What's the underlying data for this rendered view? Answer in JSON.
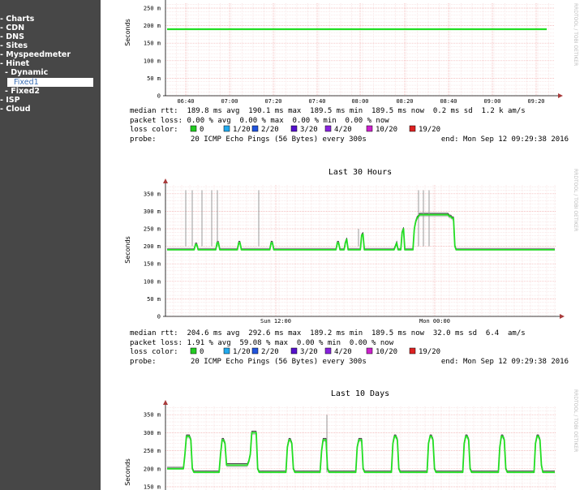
{
  "sidebar": {
    "items": [
      {
        "label": "- Charts"
      },
      {
        "label": "- CDN"
      },
      {
        "label": "- DNS"
      },
      {
        "label": "- Sites"
      },
      {
        "label": "- Myspeedmeter"
      },
      {
        "label": "- Hinet"
      },
      {
        "label": "- Dynamic"
      },
      {
        "label": "Fixed1",
        "selected": true
      },
      {
        "label": "- Fixed2"
      },
      {
        "label": "- ISP"
      },
      {
        "label": "- Cloud"
      }
    ]
  },
  "watermark": "RRDTOOL / TOBI OETIKER",
  "colors": {
    "sidebar_bg": "#474747",
    "selected_text": "#3b6fb5",
    "median_line": "#22dd22",
    "grid_major": "#f2a8a8",
    "grid_minor": "#f6dada",
    "axis_arrow": "#a83b3b"
  },
  "legend_colors": [
    {
      "label": "0",
      "color": "#22cc22"
    },
    {
      "label": "1/20",
      "color": "#22aaee"
    },
    {
      "label": "2/20",
      "color": "#2255dd"
    },
    {
      "label": "3/20",
      "color": "#5511cc"
    },
    {
      "label": "4/20",
      "color": "#8822dd"
    },
    {
      "label": "10/20",
      "color": "#cc22cc"
    },
    {
      "label": "19/20",
      "color": "#dd2222"
    }
  ],
  "chart_data": [
    {
      "type": "line",
      "title": "",
      "ylabel": "Seconds",
      "y_ticks": [
        "0",
        "50 m",
        "100 m",
        "150 m",
        "200 m",
        "250 m"
      ],
      "ylim": [
        0,
        0.25
      ],
      "x_ticks": [
        "06:40",
        "07:00",
        "07:20",
        "07:40",
        "08:00",
        "08:20",
        "08:40",
        "09:00",
        "09:20"
      ],
      "series": [
        {
          "values": [
            0.1898,
            0.1898
          ]
        }
      ],
      "stats": {
        "median_rtt": "median rtt:  189.8 ms avg  190.1 ms max  189.5 ms min  189.5 ms now  0.2 ms sd  1.2 k am/s",
        "packet_loss": "packet loss: 0.00 % avg  0.00 % max  0.00 % min  0.00 % now",
        "loss_color_label": "loss color:",
        "probe_label": "probe:",
        "probe": "20 ICMP Echo Pings (56 Bytes) every 300s",
        "end": "end: Mon Sep 12 09:29:38 2016"
      }
    },
    {
      "type": "line",
      "title": "Last 30 Hours",
      "ylabel": "Seconds",
      "y_ticks": [
        "0",
        "50 m",
        "100 m",
        "150 m",
        "200 m",
        "250 m",
        "300 m",
        "350 m"
      ],
      "ylim": [
        0,
        0.375
      ],
      "x_ticks": [
        "Sun 12:00",
        "Mon 00:00"
      ],
      "series": [
        {
          "values": [
            0.19,
            0.19,
            0.19,
            0.19,
            0.19,
            0.19,
            0.19,
            0.19,
            0.19,
            0.19,
            0.19,
            0.19,
            0.19,
            0.19,
            0.19,
            0.19,
            0.19,
            0.19,
            0.19,
            0.19,
            0.19,
            0.205,
            0.205,
            0.19,
            0.19,
            0.19,
            0.19,
            0.19,
            0.19,
            0.19,
            0.19,
            0.19,
            0.19,
            0.19,
            0.19,
            0.19,
            0.19,
            0.21,
            0.21,
            0.19,
            0.19,
            0.19,
            0.19,
            0.19,
            0.19,
            0.19,
            0.19,
            0.19,
            0.19,
            0.19,
            0.19,
            0.19,
            0.19,
            0.21,
            0.21,
            0.19,
            0.19,
            0.19,
            0.19,
            0.19,
            0.19,
            0.19,
            0.19,
            0.19,
            0.19,
            0.19,
            0.19,
            0.19,
            0.19,
            0.19,
            0.19,
            0.19,
            0.19,
            0.19,
            0.19,
            0.19,
            0.19,
            0.21,
            0.21,
            0.19,
            0.19,
            0.19,
            0.19,
            0.19,
            0.19,
            0.19,
            0.19,
            0.19,
            0.19,
            0.19,
            0.19,
            0.19,
            0.19,
            0.19,
            0.19,
            0.19,
            0.19,
            0.19,
            0.19,
            0.19,
            0.19,
            0.19,
            0.19,
            0.19,
            0.19,
            0.19,
            0.19,
            0.19,
            0.19,
            0.19,
            0.19,
            0.19,
            0.19,
            0.19,
            0.19,
            0.19,
            0.19,
            0.19,
            0.19,
            0.19,
            0.19,
            0.19,
            0.19,
            0.19,
            0.19,
            0.19,
            0.21,
            0.21,
            0.19,
            0.19,
            0.19,
            0.19,
            0.21,
            0.22,
            0.19,
            0.19,
            0.19,
            0.19,
            0.19,
            0.19,
            0.19,
            0.19,
            0.19,
            0.19,
            0.23,
            0.235,
            0.19,
            0.19,
            0.19,
            0.19,
            0.19,
            0.19,
            0.19,
            0.19,
            0.19,
            0.19,
            0.19,
            0.19,
            0.19,
            0.19,
            0.19,
            0.19,
            0.19,
            0.19,
            0.19,
            0.19,
            0.19,
            0.19,
            0.19,
            0.2,
            0.21,
            0.19,
            0.19,
            0.19,
            0.24,
            0.25,
            0.19,
            0.19,
            0.19,
            0.19,
            0.19,
            0.19,
            0.19,
            0.25,
            0.27,
            0.28,
            0.285,
            0.29,
            0.29,
            0.29,
            0.29,
            0.29,
            0.29,
            0.29,
            0.29,
            0.29,
            0.29,
            0.29,
            0.29,
            0.29,
            0.29,
            0.29,
            0.29,
            0.29,
            0.29,
            0.29,
            0.29,
            0.29,
            0.29,
            0.285,
            0.285,
            0.28,
            0.28,
            0.2,
            0.19,
            0.19,
            0.19,
            0.19,
            0.19,
            0.19,
            0.19,
            0.19,
            0.19,
            0.19,
            0.19,
            0.19,
            0.19,
            0.19,
            0.19,
            0.19,
            0.19,
            0.19,
            0.19,
            0.19,
            0.19,
            0.19,
            0.19,
            0.19,
            0.19,
            0.19,
            0.19,
            0.19,
            0.19,
            0.19,
            0.19,
            0.19,
            0.19,
            0.19,
            0.19,
            0.19,
            0.19,
            0.19,
            0.19,
            0.19,
            0.19,
            0.19,
            0.19,
            0.19,
            0.19,
            0.19,
            0.19,
            0.19,
            0.19,
            0.19,
            0.19,
            0.19,
            0.19,
            0.19,
            0.19,
            0.19,
            0.19,
            0.19,
            0.19,
            0.19,
            0.19,
            0.19,
            0.19,
            0.19,
            0.19,
            0.19,
            0.19,
            0.19,
            0.19,
            0.19,
            0.19,
            0.19,
            0.19,
            0.19
          ]
        }
      ],
      "stats": {
        "median_rtt": "median rtt:  204.6 ms avg  292.6 ms max  189.2 ms min  189.5 ms now  32.0 ms sd  6.4  am/s",
        "packet_loss": "packet loss: 1.91 % avg  59.08 % max  0.00 % min  0.00 % now",
        "loss_color_label": "loss color:",
        "probe_label": "probe:",
        "probe": "20 ICMP Echo Pings (56 Bytes) every 300s",
        "end": "end: Mon Sep 12 09:29:38 2016"
      }
    },
    {
      "type": "line",
      "title": "Last 10 Days",
      "ylabel": "Seconds",
      "y_ticks": [
        "150 m",
        "200 m",
        "250 m",
        "300 m",
        "350 m"
      ],
      "ylim": [
        0.125,
        0.375
      ],
      "x_ticks": [],
      "series": [
        {
          "values": [
            0.2,
            0.2,
            0.2,
            0.2,
            0.2,
            0.2,
            0.2,
            0.2,
            0.2,
            0.2,
            0.2,
            0.2,
            0.24,
            0.29,
            0.29,
            0.29,
            0.28,
            0.2,
            0.19,
            0.19,
            0.19,
            0.19,
            0.19,
            0.19,
            0.19,
            0.19,
            0.19,
            0.19,
            0.19,
            0.19,
            0.19,
            0.19,
            0.19,
            0.19,
            0.19,
            0.19,
            0.24,
            0.28,
            0.28,
            0.27,
            0.21,
            0.21,
            0.21,
            0.21,
            0.21,
            0.21,
            0.21,
            0.21,
            0.21,
            0.21,
            0.21,
            0.21,
            0.21,
            0.21,
            0.21,
            0.22,
            0.24,
            0.3,
            0.3,
            0.3,
            0.3,
            0.2,
            0.19,
            0.19,
            0.19,
            0.19,
            0.19,
            0.19,
            0.19,
            0.19,
            0.19,
            0.19,
            0.19,
            0.19,
            0.19,
            0.19,
            0.19,
            0.19,
            0.19,
            0.19,
            0.19,
            0.26,
            0.28,
            0.28,
            0.27,
            0.2,
            0.19,
            0.19,
            0.19,
            0.19,
            0.19,
            0.19,
            0.19,
            0.19,
            0.19,
            0.19,
            0.19,
            0.19,
            0.19,
            0.19,
            0.19,
            0.19,
            0.19,
            0.19,
            0.25,
            0.28,
            0.28,
            0.28,
            0.2,
            0.19,
            0.19,
            0.19,
            0.19,
            0.19,
            0.19,
            0.19,
            0.19,
            0.19,
            0.19,
            0.19,
            0.19,
            0.19,
            0.19,
            0.19,
            0.19,
            0.19,
            0.19,
            0.19,
            0.26,
            0.28,
            0.28,
            0.28,
            0.2,
            0.19,
            0.19,
            0.19,
            0.19,
            0.19,
            0.19,
            0.19,
            0.19,
            0.19,
            0.19,
            0.19,
            0.19,
            0.19,
            0.19,
            0.19,
            0.19,
            0.19,
            0.19,
            0.19,
            0.27,
            0.29,
            0.29,
            0.28,
            0.2,
            0.19,
            0.19,
            0.19,
            0.19,
            0.19,
            0.19,
            0.19,
            0.19,
            0.19,
            0.19,
            0.19,
            0.19,
            0.19,
            0.19,
            0.19,
            0.19,
            0.19,
            0.19,
            0.19,
            0.27,
            0.29,
            0.29,
            0.28,
            0.2,
            0.19,
            0.19,
            0.19,
            0.19,
            0.19,
            0.19,
            0.19,
            0.19,
            0.19,
            0.19,
            0.19,
            0.19,
            0.19,
            0.19,
            0.19,
            0.19,
            0.19,
            0.19,
            0.19,
            0.27,
            0.29,
            0.29,
            0.28,
            0.2,
            0.19,
            0.19,
            0.19,
            0.19,
            0.19,
            0.19,
            0.19,
            0.19,
            0.19,
            0.19,
            0.19,
            0.19,
            0.19,
            0.19,
            0.19,
            0.19,
            0.19,
            0.19,
            0.19,
            0.26,
            0.29,
            0.29,
            0.28,
            0.2,
            0.19,
            0.19,
            0.19,
            0.19,
            0.19,
            0.19,
            0.19,
            0.19,
            0.19,
            0.19,
            0.19,
            0.19,
            0.19,
            0.19,
            0.19,
            0.19,
            0.19,
            0.19,
            0.19,
            0.27,
            0.29,
            0.29,
            0.28,
            0.21,
            0.19,
            0.19,
            0.19,
            0.19,
            0.19,
            0.19,
            0.19,
            0.19,
            0.19
          ]
        }
      ],
      "stats": null
    }
  ]
}
